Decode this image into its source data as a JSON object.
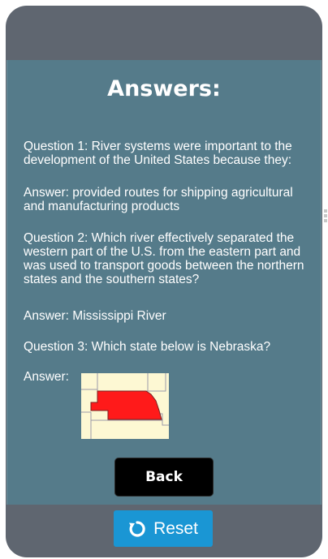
{
  "title": "Answers:",
  "questions": [
    {
      "question": "Question 1: River systems were important to the development of the United States because they:",
      "answer": "Answer: provided routes for shipping agricultural and manufacturing products"
    },
    {
      "question": "Question 2: Which river effectively separated the western part of the U.S. from the eastern part and was used to transport goods between the northern states and the southern states?",
      "answer": "Answer: Mississippi River"
    },
    {
      "question": "Question 3: Which state below is Nebraska?",
      "answer_label": "Answer:"
    }
  ],
  "map": {
    "highlight_color": "#ff1a1a",
    "land_color": "#fdf8d3",
    "border_color": "#9a9aa8"
  },
  "buttons": {
    "back": "Back",
    "reset": "Reset"
  },
  "icons": {
    "reset": "refresh-icon"
  },
  "colors": {
    "frame": "#5f6670",
    "panel": "#557b8a",
    "back_button": "#000000",
    "reset_button": "#1a96d4"
  }
}
